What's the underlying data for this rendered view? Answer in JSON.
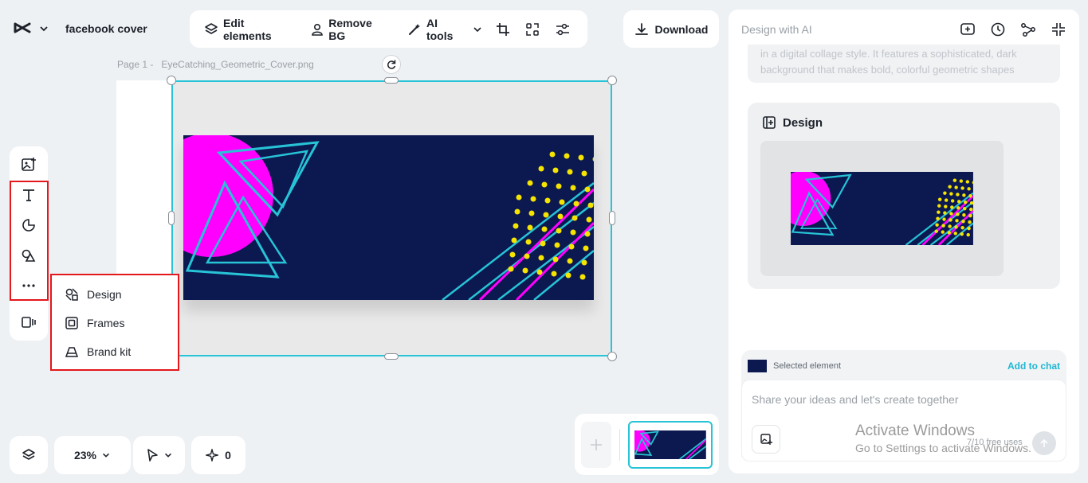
{
  "header": {
    "project_title": "facebook cover"
  },
  "toolbar": {
    "edit_elements": "Edit elements",
    "remove_bg": "Remove BG",
    "ai_tools": "AI tools",
    "download": "Download"
  },
  "canvas": {
    "page_label": "Page 1 -   EyeCatching_Geometric_Cover.png"
  },
  "more_menu": {
    "items": [
      {
        "label": "Design"
      },
      {
        "label": "Frames"
      },
      {
        "label": "Brand kit"
      }
    ]
  },
  "bottom": {
    "zoom": "23%",
    "ai_credits": "0"
  },
  "right_panel": {
    "title": "Design with AI",
    "faded_text": "in a digital collage style. It features a sophisticated, dark background that makes bold, colorful geometric shapes",
    "design_heading": "Design",
    "selected_element": "Selected element",
    "add_to_chat": "Add to chat",
    "chat_placeholder": "Share your ideas and let's create together",
    "free_uses": "7/10 free uses"
  },
  "watermark": {
    "line1": "Activate Windows",
    "line2": "Go to Settings to activate Windows."
  },
  "colors": {
    "accent": "#27c3d6",
    "highlight": "#e3171c",
    "cover_bg": "#0c1850",
    "magenta": "#ff00ff",
    "yellow": "#f5e400"
  }
}
